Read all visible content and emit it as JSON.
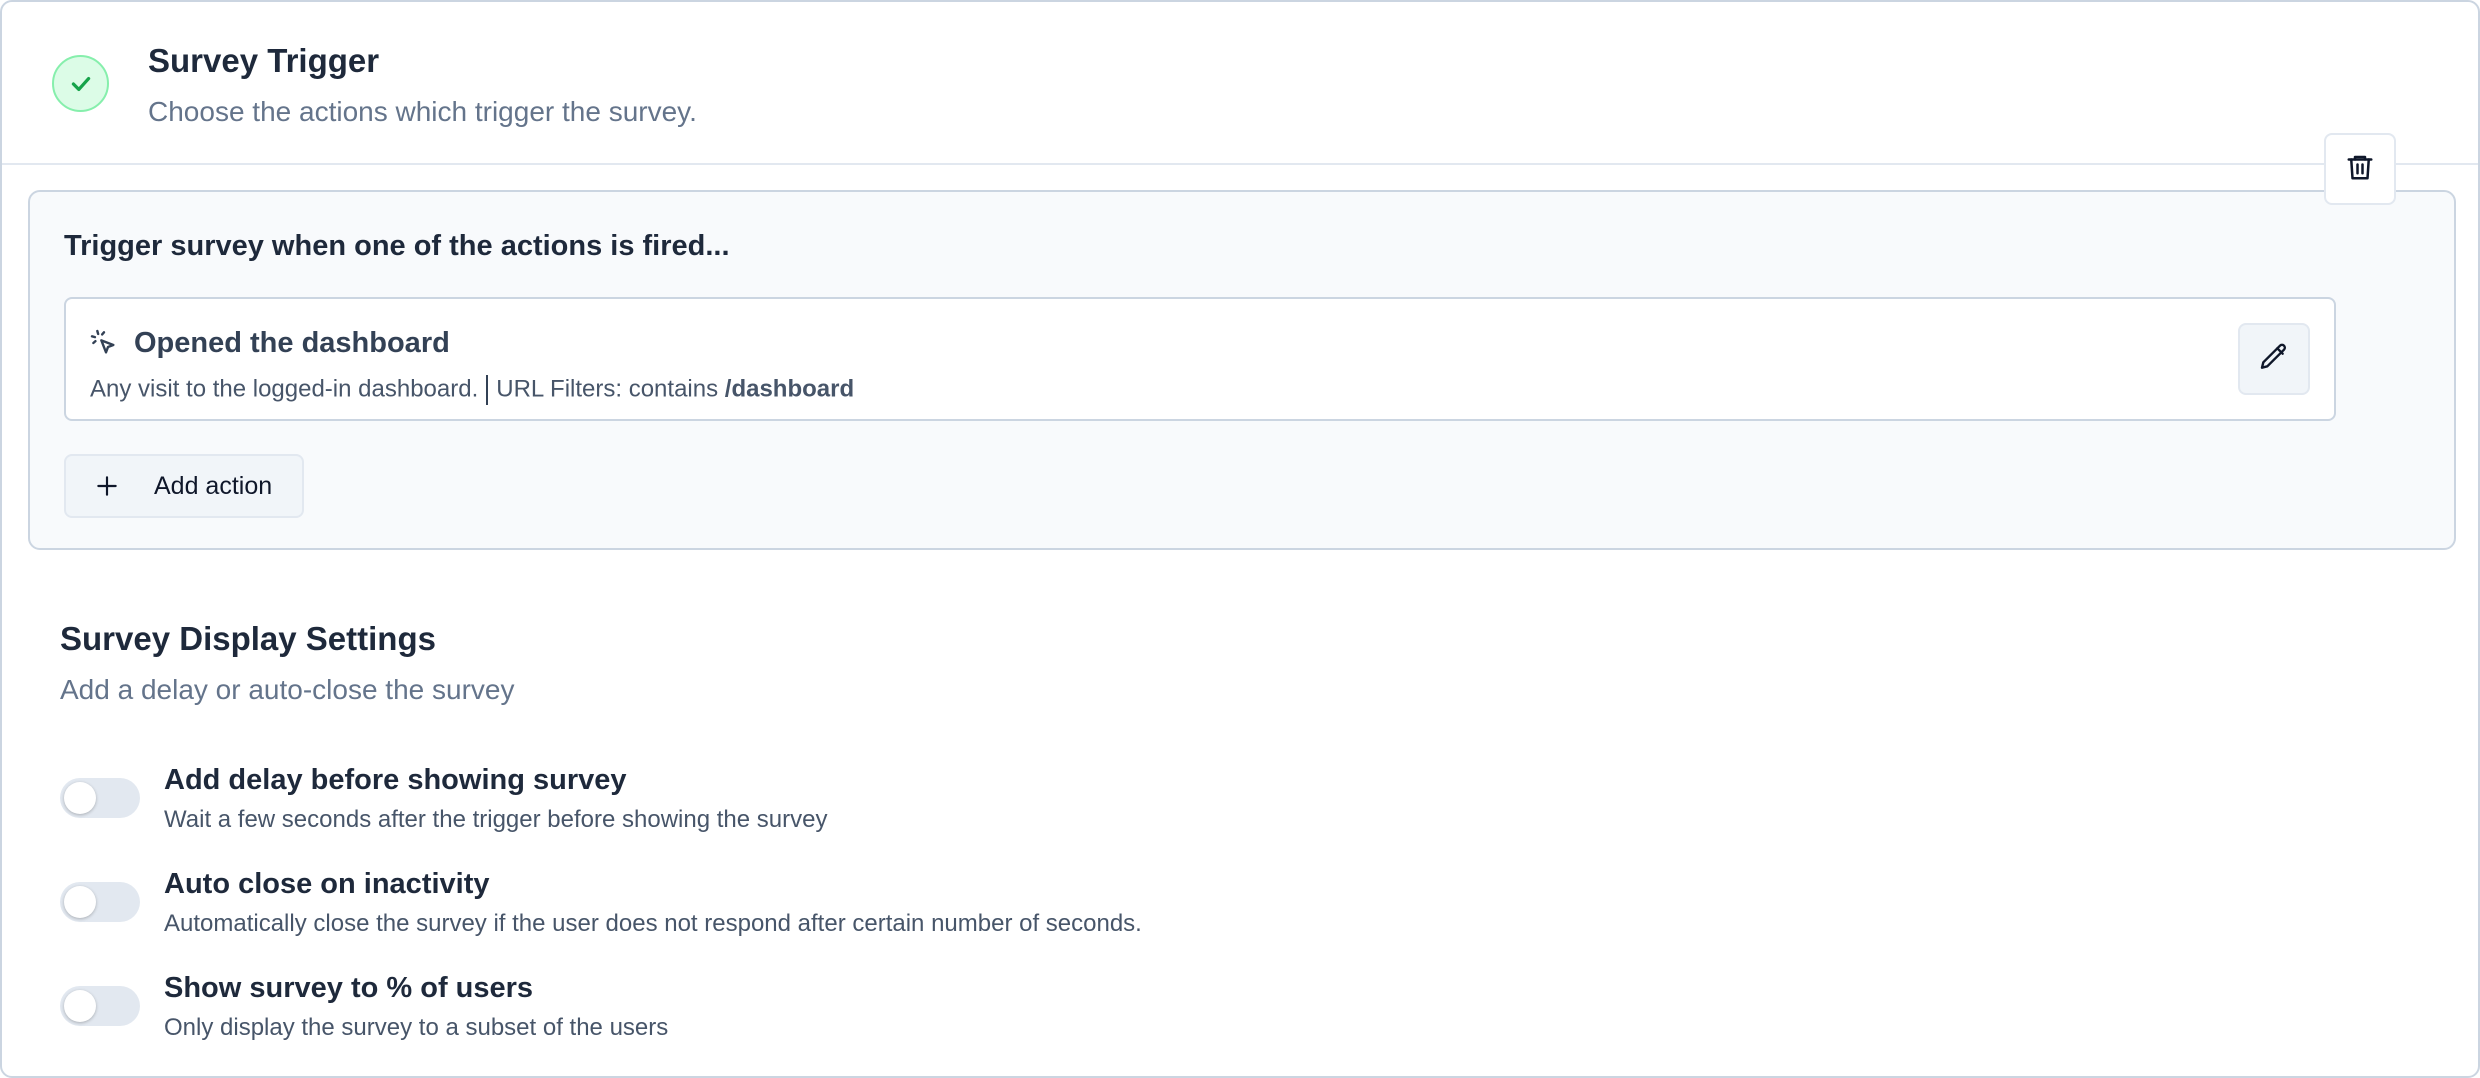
{
  "header": {
    "title": "Survey Trigger",
    "subtitle": "Choose the actions which trigger the survey."
  },
  "trigger": {
    "heading": "Trigger survey when one of the actions is fired...",
    "actions": [
      {
        "name": "Opened the dashboard",
        "description": "Any visit to the logged-in dashboard.",
        "filter_label": "URL Filters: contains",
        "filter_value": "/dashboard"
      }
    ],
    "add_action_label": "Add action"
  },
  "display": {
    "title": "Survey Display Settings",
    "subtitle": "Add a delay or auto-close the survey",
    "settings": [
      {
        "title": "Add delay before showing survey",
        "description": "Wait a few seconds after the trigger before showing the survey",
        "enabled": false
      },
      {
        "title": "Auto close on inactivity",
        "description": "Automatically close the survey if the user does not respond after certain number of seconds.",
        "enabled": false
      },
      {
        "title": "Show survey to % of users",
        "description": "Only display the survey to a subset of the users",
        "enabled": false
      }
    ]
  },
  "colors": {
    "success_bg": "#dcfce7",
    "success_check": "#16a34a",
    "border": "#cbd5e1",
    "toggle_off": "#e2e8f0"
  },
  "icons": {
    "status": "check-icon",
    "action": "cursor-click-icon",
    "edit": "pencil-icon",
    "delete": "trash-icon",
    "add": "plus-icon"
  }
}
